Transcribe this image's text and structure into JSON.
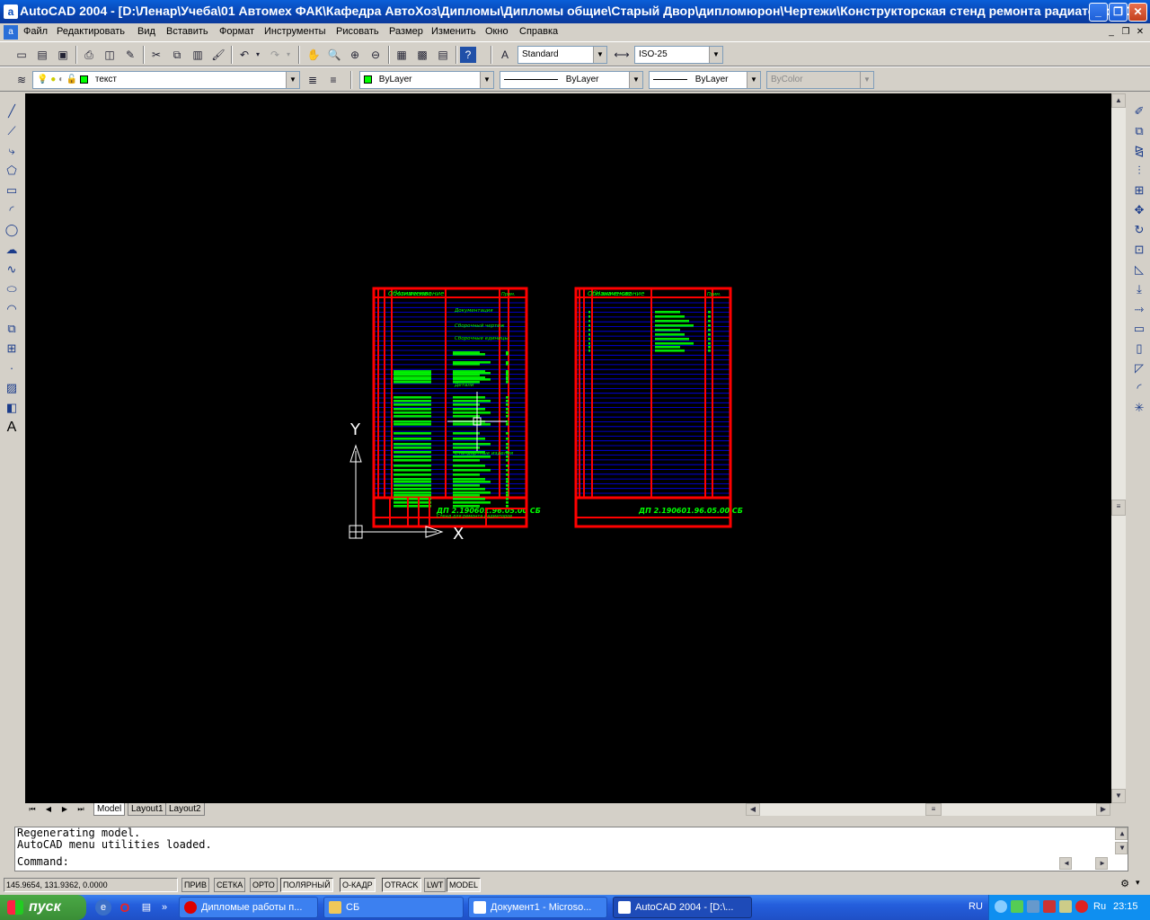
{
  "window": {
    "title": "AutoCAD 2004 - [D:\\Ленар\\Учеба\\01 Автомех ФАК\\Кафедра АвтоХоз\\Дипломы\\Дипломы общие\\Старый Двор\\дипломюрон\\Чертежи\\Конструкторская стенд ремонта радиаторов\\СБ]",
    "minimize": "_",
    "maximize": "❐",
    "close": "✕"
  },
  "menu": {
    "items": [
      "Файл",
      "Редактировать",
      "Вид",
      "Вставить",
      "Формат",
      "Инструменты",
      "Рисовать",
      "Размер",
      "Изменить",
      "Окно",
      "Справка"
    ]
  },
  "standard_toolbar": {
    "text_style": "Standard",
    "dim_style": "ISO-25"
  },
  "layers_toolbar": {
    "current_layer": "текст",
    "color": "ByLayer",
    "linetype": "ByLayer",
    "lineweight": "ByLayer",
    "plotstyle": "ByColor",
    "layer_color": "#00ff00"
  },
  "drawing": {
    "background": "#000000",
    "frame_color": "#ff0000",
    "line_color": "#0000ff",
    "text_color": "#00ff00",
    "sheet1": {
      "header_designation": "Обозначение",
      "header_name": "Наименование",
      "header_note": "Прим.",
      "section_docs": "Документация",
      "doc_name": "Сборочный чертеж",
      "section_units": "Сборочные единицы",
      "section_parts": "Детали",
      "section_std": "Стандартные изделия",
      "stamp_code": "ДП 2.190601.96.05.00 СБ",
      "stamp_title": "Стенд для ремонта радиаторов"
    },
    "sheet2": {
      "header_designation": "Обозначение",
      "header_name": "Наименование",
      "header_note": "Прим.",
      "stamp_code": "ДП 2.190601.96.05.00 СБ"
    },
    "ucs_x": "X",
    "ucs_y": "Y"
  },
  "layout_tabs": [
    "Model",
    "Layout1",
    "Layout2"
  ],
  "command_lines": [
    "Regenerating model.",
    "AutoCAD menu utilities loaded.",
    "Command:"
  ],
  "status": {
    "coordinates": "145.9654, 131.9362, 0.0000",
    "buttons": [
      "ПРИВ",
      "СЕТКА",
      "ОРТО",
      "ПОЛЯРНЫЙ",
      "О-КАДР",
      "OTRACK",
      "LWT",
      "MODEL"
    ]
  },
  "taskbar": {
    "start": "пуск",
    "tasks": [
      "Дипломые работы п...",
      "СБ",
      "Документ1 - Microso...",
      "AutoCAD 2004 - [D:\\..."
    ],
    "lang": "RU",
    "lang2": "Ru",
    "time": "23:15"
  }
}
